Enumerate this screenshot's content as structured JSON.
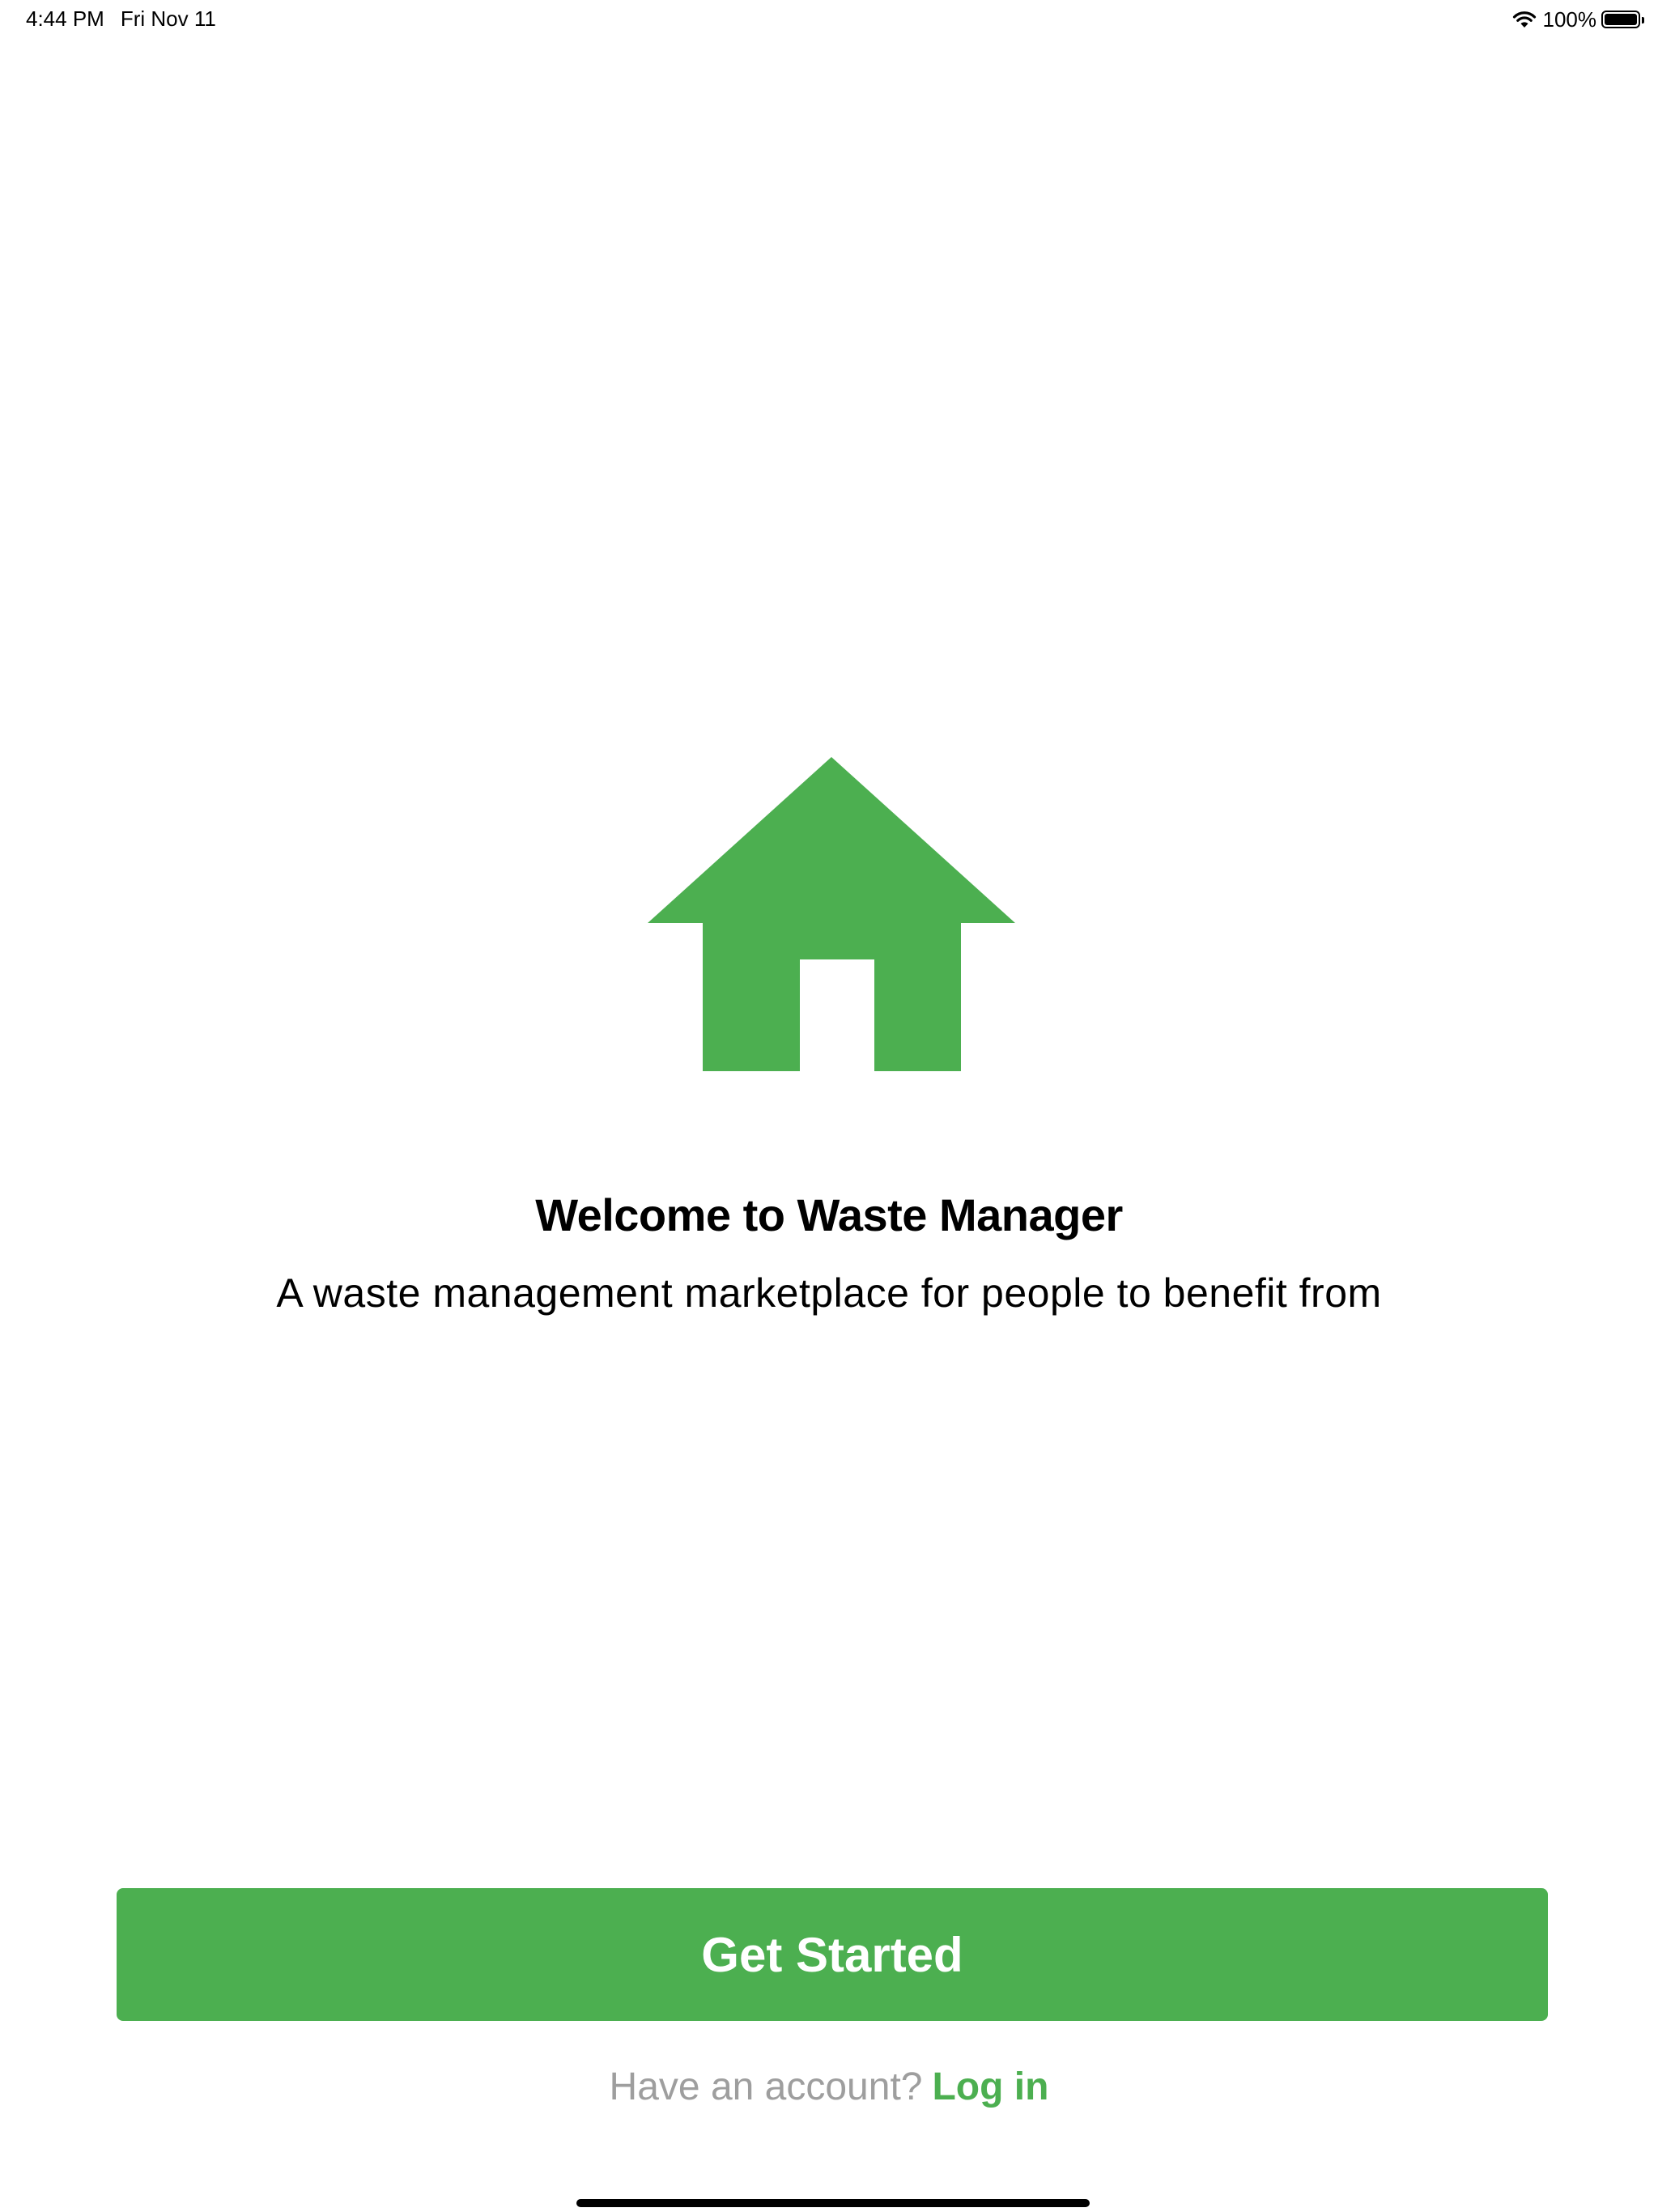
{
  "status_bar": {
    "time": "4:44 PM",
    "date": "Fri Nov 11",
    "battery_text": "100%",
    "battery_level": 1.0
  },
  "hero": {
    "icon": "house-icon",
    "title": "Welcome to Waste Manager",
    "subtitle": "A waste management marketplace for people to benefit from"
  },
  "actions": {
    "get_started_label": "Get Started",
    "login_prompt": "Have an account?",
    "login_label": "Log in"
  },
  "colors": {
    "accent": "#4caf50",
    "muted_text": "#9e9e9e",
    "background": "#ffffff"
  }
}
